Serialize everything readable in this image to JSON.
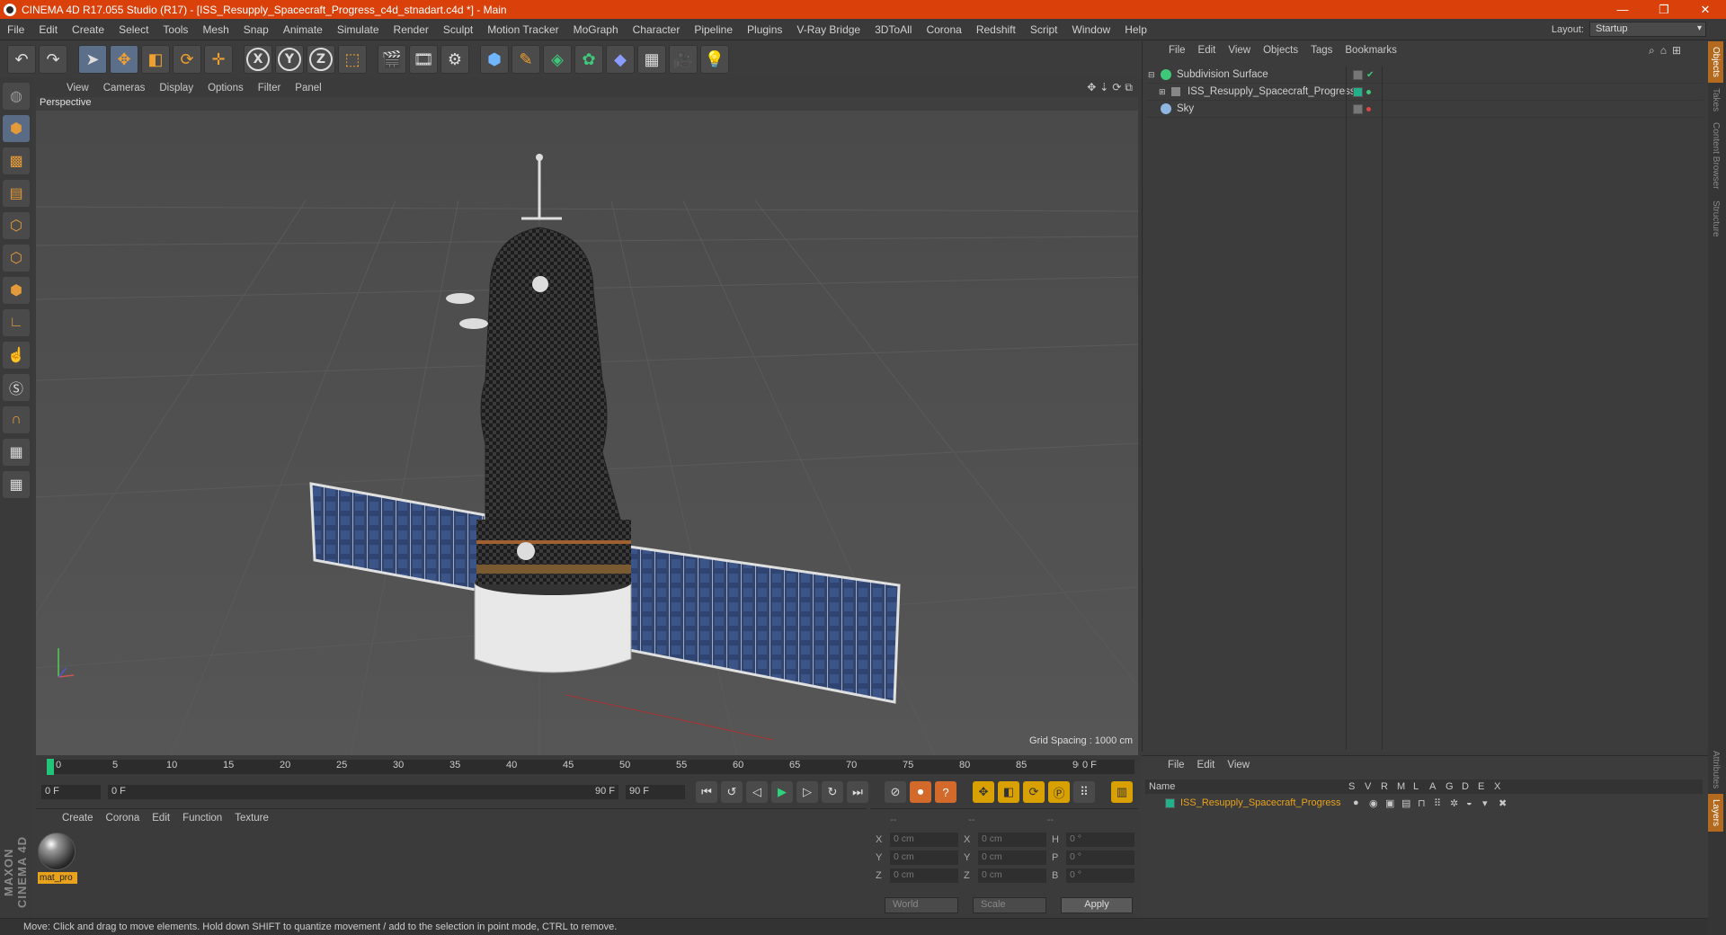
{
  "window": {
    "title": "CINEMA 4D R17.055 Studio (R17) - [ISS_Resupply_Spacecraft_Progress_c4d_stnadart.c4d *] - Main"
  },
  "menu": [
    "File",
    "Edit",
    "Create",
    "Select",
    "Tools",
    "Mesh",
    "Snap",
    "Animate",
    "Simulate",
    "Render",
    "Sculpt",
    "Motion Tracker",
    "MoGraph",
    "Character",
    "Pipeline",
    "Plugins",
    "V-Ray Bridge",
    "3DToAll",
    "Corona",
    "Redshift",
    "Script",
    "Window",
    "Help"
  ],
  "layout": {
    "label": "Layout:",
    "value": "Startup"
  },
  "viewport": {
    "menu": [
      "View",
      "Cameras",
      "Display",
      "Options",
      "Filter",
      "Panel"
    ],
    "label": "Perspective",
    "grid_spacing": "Grid Spacing : 1000 cm"
  },
  "objects_panel": {
    "menu": [
      "File",
      "Edit",
      "View",
      "Objects",
      "Tags",
      "Bookmarks"
    ],
    "items": [
      {
        "name": "Subdivision Surface"
      },
      {
        "name": "ISS_Resupply_Spacecraft_Progress"
      },
      {
        "name": "Sky"
      }
    ]
  },
  "side_tabs": [
    "Objects",
    "Takes",
    "Content Browser",
    "Structure"
  ],
  "side_tabs_lower": [
    "Attributes",
    "Layers"
  ],
  "timeline": {
    "ticks": [
      "0",
      "5",
      "10",
      "15",
      "20",
      "25",
      "30",
      "35",
      "40",
      "45",
      "50",
      "55",
      "60",
      "65",
      "70",
      "75",
      "80",
      "85",
      "90"
    ],
    "current_frame": "0 F",
    "start_field": "0 F",
    "range_start": "0 F",
    "range_end": "90 F",
    "end_field": "90 F"
  },
  "material_panel": {
    "menu": [
      "Create",
      "Corona",
      "Edit",
      "Function",
      "Texture"
    ],
    "material_name": "mat_pro"
  },
  "coords": {
    "header": [
      "--",
      "--",
      "--"
    ],
    "rows": [
      {
        "a1": "X",
        "v1": "0 cm",
        "a2": "X",
        "v2": "0 cm",
        "a3": "H",
        "v3": "0 °"
      },
      {
        "a1": "Y",
        "v1": "0 cm",
        "a2": "Y",
        "v2": "0 cm",
        "a3": "P",
        "v3": "0 °"
      },
      {
        "a1": "Z",
        "v1": "0 cm",
        "a2": "Z",
        "v2": "0 cm",
        "a3": "B",
        "v3": "0 °"
      }
    ],
    "world": "World",
    "scale": "Scale",
    "apply": "Apply"
  },
  "layers_panel": {
    "menu": [
      "File",
      "Edit",
      "View"
    ],
    "col_name": "Name",
    "cols": [
      "S",
      "V",
      "R",
      "M",
      "L",
      "A",
      "G",
      "D",
      "E",
      "X"
    ],
    "layer_name": "ISS_Resupply_Spacecraft_Progress"
  },
  "branding": "MAXON CINEMA 4D",
  "status": "Move: Click and drag to move elements. Hold down SHIFT to quantize movement / add to the selection in point mode, CTRL to remove.",
  "colors": {
    "title_bar": "#d9400a",
    "accent_green": "#22b08a",
    "material_label": "#e8a21c"
  }
}
